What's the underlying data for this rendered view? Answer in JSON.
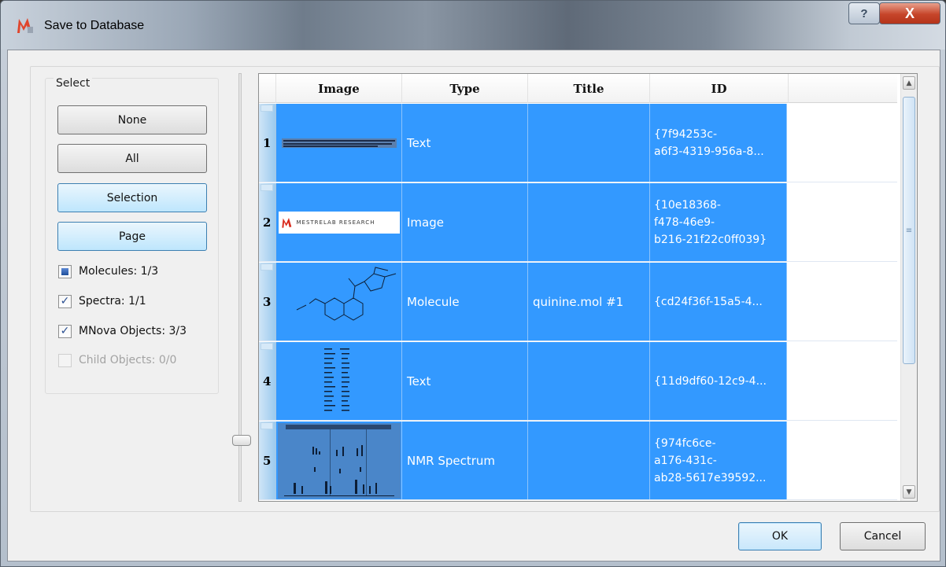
{
  "window": {
    "title": "Save to Database",
    "help_label": "?",
    "close_label": "X"
  },
  "select": {
    "group_title": "Select",
    "buttons": {
      "none": "None",
      "all": "All",
      "selection": "Selection",
      "page": "Page"
    },
    "checks": [
      {
        "label": "Molecules: 1/3",
        "state": "partial"
      },
      {
        "label": "Spectra: 1/1",
        "state": "checked"
      },
      {
        "label": "MNova Objects: 3/3",
        "state": "checked"
      },
      {
        "label": "Child Objects: 0/0",
        "state": "disabled"
      }
    ]
  },
  "table": {
    "columns": [
      "Image",
      "Type",
      "Title",
      "ID"
    ],
    "rows": [
      {
        "num": "1",
        "type": "Text",
        "title": "",
        "id_lines": [
          "{7f94253c-",
          "a6f3-4319-956a-8..."
        ],
        "thumb": "text-lines"
      },
      {
        "num": "2",
        "type": "Image",
        "title": "",
        "id_lines": [
          "{10e18368-",
          "f478-46e9-",
          "b216-21f22c0ff039}"
        ],
        "thumb": "logo"
      },
      {
        "num": "3",
        "type": "Molecule",
        "title": "quinine.mol #1",
        "id_lines": [
          "{cd24f36f-15a5-4..."
        ],
        "thumb": "molecule"
      },
      {
        "num": "4",
        "type": "Text",
        "title": "",
        "id_lines": [
          "{11d9df60-12c9-4..."
        ],
        "thumb": "text-column"
      },
      {
        "num": "5",
        "type": "NMR Spectrum",
        "title": "",
        "id_lines": [
          "{974fc6ce-",
          "a176-431c-",
          "ab28-5617e39592..."
        ],
        "thumb": "spectrum"
      }
    ],
    "logo_text": "MESTRELAB RESEARCH"
  },
  "footer": {
    "ok": "OK",
    "cancel": "Cancel"
  },
  "colors": {
    "selection": "#3399ff",
    "accent": "#3c7fb1"
  }
}
